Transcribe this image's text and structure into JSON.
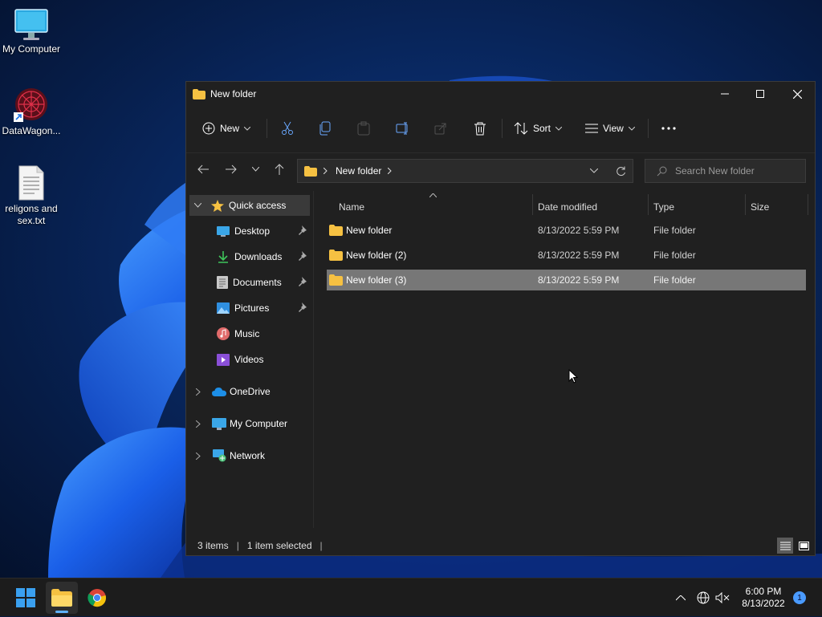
{
  "desktop": {
    "icons": [
      {
        "label": "My Computer",
        "icon": "monitor-icon"
      },
      {
        "label": "DataWagon...",
        "icon": "datawagon-icon"
      },
      {
        "label": "religons and sex.txt",
        "icon": "text-file-icon"
      }
    ]
  },
  "window": {
    "title": "New folder",
    "toolbar": {
      "new_label": "New",
      "sort_label": "Sort",
      "view_label": "View"
    },
    "address": {
      "path": [
        "New folder"
      ]
    },
    "search": {
      "placeholder": "Search New folder"
    },
    "sidebar": {
      "quick_access": {
        "label": "Quick access",
        "items": [
          {
            "label": "Desktop",
            "pinned": true,
            "icon": "desktop-icon"
          },
          {
            "label": "Downloads",
            "pinned": true,
            "icon": "download-icon"
          },
          {
            "label": "Documents",
            "pinned": true,
            "icon": "documents-icon"
          },
          {
            "label": "Pictures",
            "pinned": true,
            "icon": "pictures-icon"
          },
          {
            "label": "Music",
            "pinned": false,
            "icon": "music-icon"
          },
          {
            "label": "Videos",
            "pinned": false,
            "icon": "videos-icon"
          }
        ]
      },
      "roots": [
        {
          "label": "OneDrive",
          "icon": "cloud-icon"
        },
        {
          "label": "My Computer",
          "icon": "computer-icon"
        },
        {
          "label": "Network",
          "icon": "network-icon"
        }
      ]
    },
    "columns": [
      "Name",
      "Date modified",
      "Type",
      "Size"
    ],
    "rows": [
      {
        "name": "New folder",
        "date": "8/13/2022 5:59 PM",
        "type": "File folder",
        "size": "",
        "selected": false
      },
      {
        "name": "New folder (2)",
        "date": "8/13/2022 5:59 PM",
        "type": "File folder",
        "size": "",
        "selected": false
      },
      {
        "name": "New folder (3)",
        "date": "8/13/2022 5:59 PM",
        "type": "File folder",
        "size": "",
        "selected": true
      }
    ],
    "status": {
      "item_count": "3 items",
      "selection": "1 item selected"
    }
  },
  "taskbar": {
    "clock": {
      "time": "6:00 PM",
      "date": "8/13/2022"
    },
    "notification_count": "1"
  },
  "colors": {
    "accent": "#0078d4",
    "folder": "#f6c142",
    "window_bg": "#202020",
    "selection": "#777777"
  }
}
